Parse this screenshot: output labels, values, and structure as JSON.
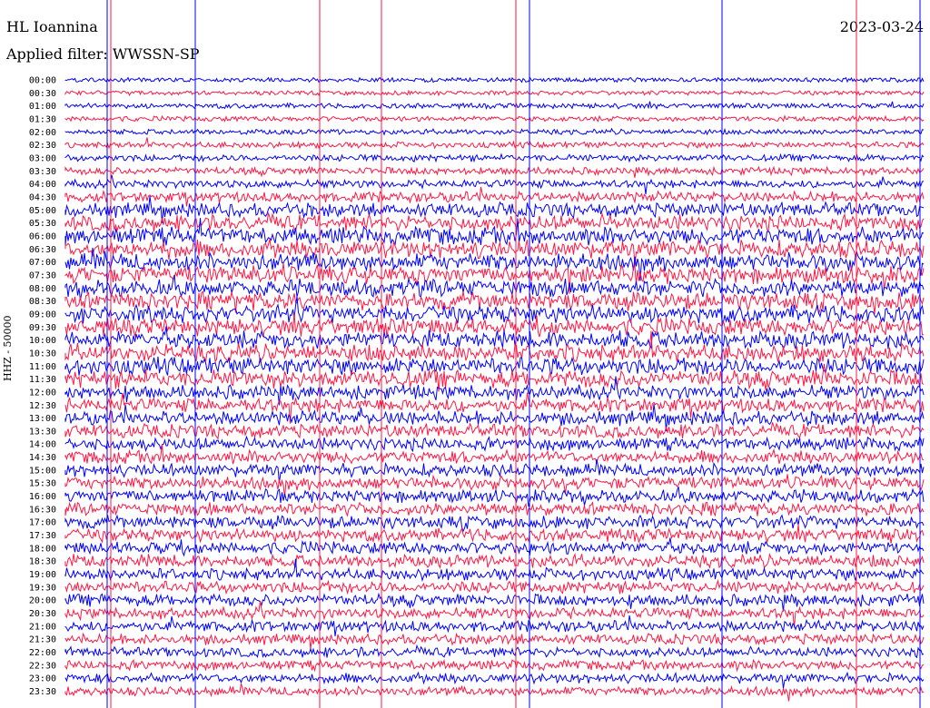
{
  "header": {
    "station": "HL Ioannina",
    "date": "2023-03-24",
    "filter": "Applied filter: WWSSN-SP"
  },
  "axis": {
    "ylabel": "HHZ - 50000"
  },
  "colors": {
    "trace_a": "#0000ff",
    "trace_b": "#ff1744",
    "background": "#ffffff"
  },
  "chart_data": {
    "type": "line",
    "title": "HL Ioannina",
    "ylabel": "HHZ - 50000",
    "row_labels": [
      "00:00",
      "00:30",
      "01:00",
      "01:30",
      "02:00",
      "02:30",
      "03:00",
      "03:30",
      "04:00",
      "04:30",
      "05:00",
      "05:30",
      "06:00",
      "06:30",
      "07:00",
      "07:30",
      "08:00",
      "08:30",
      "09:00",
      "09:30",
      "10:00",
      "10:30",
      "11:00",
      "11:30",
      "12:00",
      "12:30",
      "13:00",
      "13:30",
      "14:00",
      "14:30",
      "15:00",
      "15:30",
      "16:00",
      "16:30",
      "17:00",
      "17:30",
      "18:00",
      "18:30",
      "19:00",
      "19:30",
      "20:00",
      "20:30",
      "21:00",
      "21:30",
      "22:00",
      "22:30",
      "23:00",
      "23:30"
    ],
    "row_activity": [
      0.15,
      0.15,
      0.2,
      0.2,
      0.2,
      0.25,
      0.3,
      0.35,
      0.4,
      0.55,
      0.8,
      0.9,
      1.0,
      1.0,
      1.0,
      1.0,
      1.0,
      1.0,
      1.0,
      1.0,
      1.0,
      1.0,
      1.0,
      1.0,
      0.8,
      0.8,
      0.8,
      0.75,
      0.7,
      0.7,
      0.7,
      0.7,
      0.7,
      0.7,
      0.7,
      0.7,
      0.7,
      0.7,
      0.65,
      0.65,
      0.65,
      0.6,
      0.6,
      0.55,
      0.5,
      0.5,
      0.5,
      0.45
    ],
    "series": [
      {
        "name": "",
        "color": "#0000ff"
      },
      {
        "name": "",
        "color": "#ff1744"
      }
    ]
  }
}
